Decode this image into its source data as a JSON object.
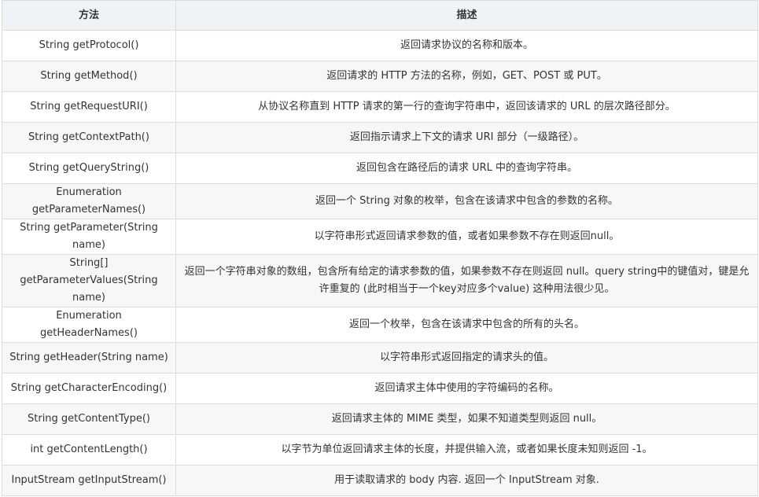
{
  "table": {
    "headers": {
      "method": "方法",
      "description": "描述"
    },
    "rows": [
      {
        "method": "String getProtocol()",
        "description": "返回请求协议的名称和版本。"
      },
      {
        "method": "String getMethod()",
        "description": "返回请求的 HTTP 方法的名称，例如，GET、POST 或 PUT。"
      },
      {
        "method": "String getRequestURI()",
        "description": "从协议名称直到 HTTP 请求的第一行的查询字符串中，返回该请求的 URL 的层次路径部分。"
      },
      {
        "method": "String getContextPath()",
        "description": "返回指示请求上下文的请求 URI 部分（一级路径）。"
      },
      {
        "method": "String getQueryString()",
        "description": "返回包含在路径后的请求 URL 中的查询字符串。"
      },
      {
        "method": "Enumeration getParameterNames()",
        "description": "返回一个 String 对象的枚举，包含在该请求中包含的参数的名称。"
      },
      {
        "method": "String getParameter(String name)",
        "description": "以字符串形式返回请求参数的值，或者如果参数不存在则返回null。"
      },
      {
        "method": "String[] getParameterValues(String name)",
        "description": "返回一个字符串对象的数组，包含所有给定的请求参数的值，如果参数不存在则返回 null。query string中的键值对，键是允许重复的 (此时相当于一个key对应多个value) 这种用法很少见。"
      },
      {
        "method": "Enumeration getHeaderNames()",
        "description": "返回一个枚举，包含在该请求中包含的所有的头名。"
      },
      {
        "method": "String getHeader(String name)",
        "description": "以字符串形式返回指定的请求头的值。"
      },
      {
        "method": "String getCharacterEncoding()",
        "description": "返回请求主体中使用的字符编码的名称。"
      },
      {
        "method": "String getContentType()",
        "description": "返回请求主体的 MIME 类型，如果不知道类型则返回 null。"
      },
      {
        "method": "int getContentLength()",
        "description": "以字节为单位返回请求主体的长度，并提供输入流，或者如果长度未知则返回 -1。"
      },
      {
        "method": "InputStream getInputStream()",
        "description": "用于读取请求的 body 内容. 返回一个 InputStream 对象."
      }
    ]
  }
}
